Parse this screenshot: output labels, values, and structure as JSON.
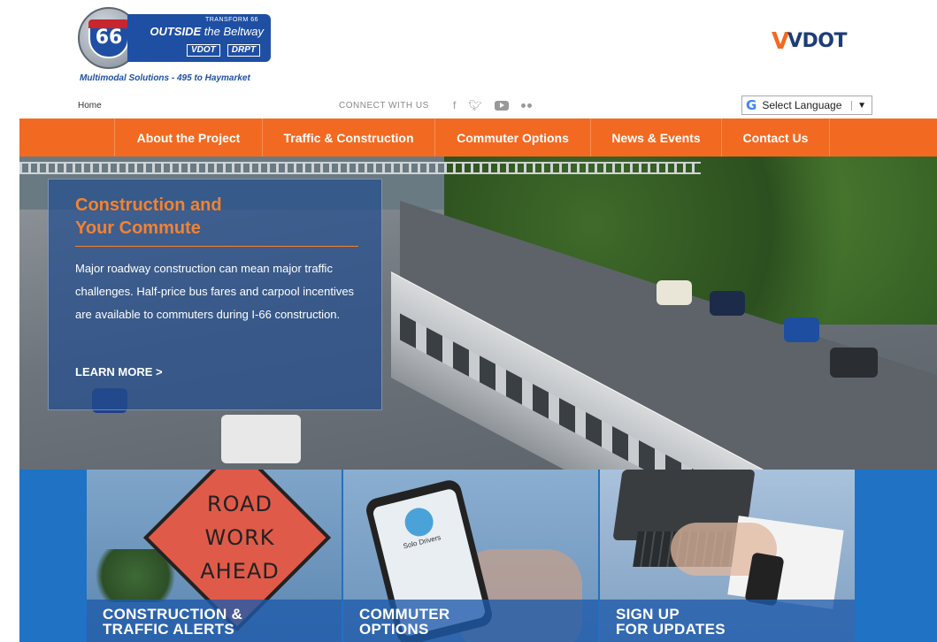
{
  "header": {
    "logo": {
      "shield_number": "66",
      "banner_small": "TRANSFORM 66",
      "banner_main_bold": "OUTSIDE",
      "banner_main_rest": " the Beltway",
      "banner_sub_1": "VDOT",
      "banner_sub_2": "DRPT",
      "tagline": "Multimodal Solutions - 495 to Haymarket"
    },
    "vdot_logo": "VDOT",
    "home_link": "Home",
    "connect_label": "CONNECT WITH US",
    "social_icons": [
      "facebook-icon",
      "twitter-icon",
      "youtube-icon",
      "flickr-icon"
    ],
    "language_selector": {
      "label": "Select Language",
      "arrow": "▼"
    }
  },
  "nav": {
    "items": [
      {
        "label": "About the Project"
      },
      {
        "label": "Traffic & Construction"
      },
      {
        "label": "Commuter Options"
      },
      {
        "label": "News & Events"
      },
      {
        "label": "Contact Us"
      }
    ]
  },
  "hero": {
    "title_line1": "Construction and",
    "title_line2": "Your Commute",
    "body": "Major roadway construction can mean major traffic challenges. Half-price bus fares and carpool incentives are available to commuters during I-66 construction.",
    "link": "LEARN MORE >"
  },
  "tiles": [
    {
      "line1": "CONSTRUCTION &",
      "line2": "TRAFFIC ALERTS",
      "sign_text": [
        "ROAD",
        "WORK",
        "AHEAD"
      ]
    },
    {
      "line1": "COMMUTER",
      "line2": "OPTIONS",
      "phone_heading": "Solo Drivers"
    },
    {
      "line1": "SIGN UP",
      "line2": "FOR UPDATES"
    }
  ],
  "colors": {
    "nav_orange": "#f26a21",
    "brand_blue": "#1e4fa3",
    "tile_blue": "#1f72c4",
    "hero_title_orange": "#f5822f"
  }
}
